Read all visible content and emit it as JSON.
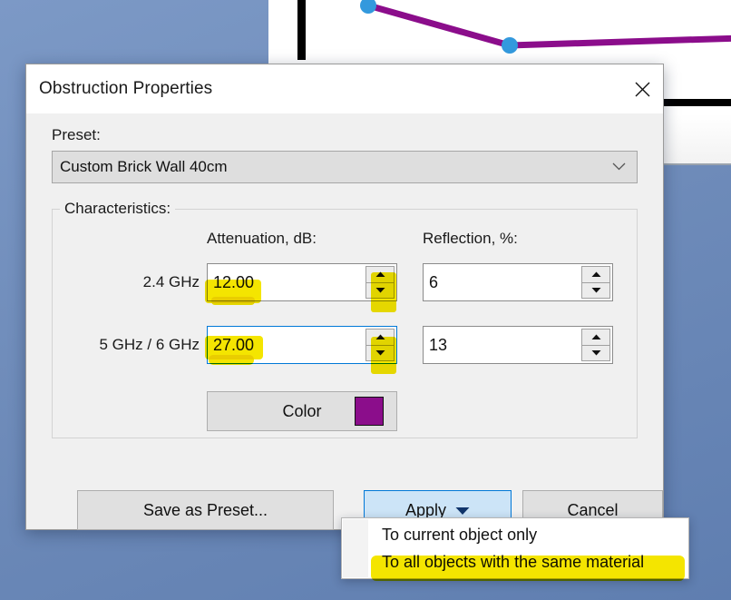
{
  "window": {
    "title": "Obstruction Properties",
    "close_icon": "close-icon"
  },
  "preset": {
    "label": "Preset:",
    "value": "Custom Brick Wall 40cm",
    "dropdown_icon": "chevron-down-icon"
  },
  "characteristics": {
    "legend": "Characteristics:",
    "columns": {
      "attenuation": "Attenuation, dB:",
      "reflection": "Reflection, %:"
    },
    "rows": [
      {
        "band": "2.4 GHz",
        "attenuation": "12.00",
        "reflection": "6",
        "focused": false
      },
      {
        "band": "5 GHz / 6 GHz",
        "attenuation": "27.00",
        "reflection": "13",
        "focused": true
      }
    ],
    "color_button": {
      "label": "Color",
      "swatch_hex": "#8b0d8b"
    }
  },
  "footer": {
    "save_label": "Save as Preset...",
    "apply_label": "Apply",
    "apply_caret_icon": "caret-down-icon",
    "cancel_label": "Cancel"
  },
  "apply_menu": {
    "items": [
      {
        "label": "To current object only",
        "highlighted": false
      },
      {
        "label": "To all objects with the same material",
        "highlighted": true
      }
    ]
  },
  "background": {
    "desktop_hex": "#6f8cba",
    "canvas_hex": "#ffffff",
    "obstruction_line_hex": "#8b0d8b",
    "vertex_hex": "#3399dd",
    "wall_hex": "#000000"
  },
  "annotations": {
    "marker_hex": "#f4e500",
    "marked": [
      "attenuation-2.4-value",
      "attenuation-2.4-spinner",
      "attenuation-5-value",
      "attenuation-5-spinner",
      "menu-item-all-objects"
    ]
  }
}
